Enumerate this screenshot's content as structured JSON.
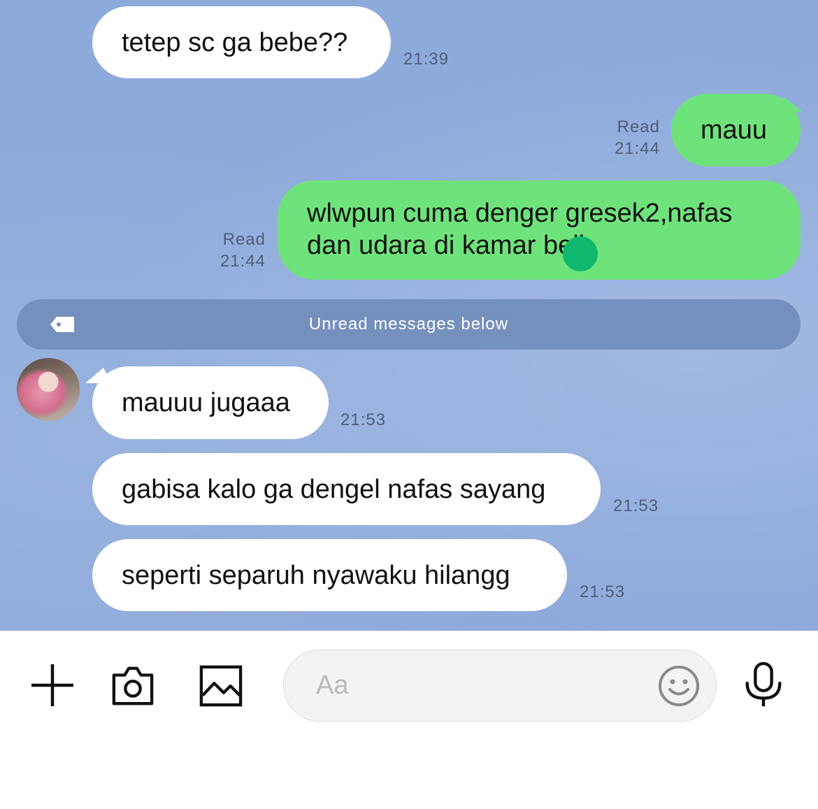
{
  "messages": [
    {
      "text": "tetep sc ga bebe??",
      "time": "21:39"
    },
    {
      "text": "mauu",
      "read": "Read",
      "time": "21:44"
    },
    {
      "line1": "wlwpun cuma denger gresek2,nafas",
      "line2": "dan udara di kamar beli",
      "read": "Read",
      "time": "21:44"
    },
    {
      "text": "mauuu jugaaa",
      "time": "21:53"
    },
    {
      "text": "gabisa kalo ga dengel nafas sayang",
      "time": "21:53"
    },
    {
      "text": "seperti separuh nyawaku hilangg",
      "time": "21:53"
    }
  ],
  "unread_banner": "Unread messages below",
  "composer": {
    "placeholder": "Aa"
  },
  "icons": [
    "plus-icon",
    "camera-icon",
    "image-icon",
    "emoji-icon",
    "mic-icon",
    "tag-icon"
  ],
  "colors": {
    "background": "#8eaadb",
    "outgoing_bubble": "#6fe37b",
    "incoming_bubble": "#ffffff",
    "unread_bar": "#7590bd"
  }
}
